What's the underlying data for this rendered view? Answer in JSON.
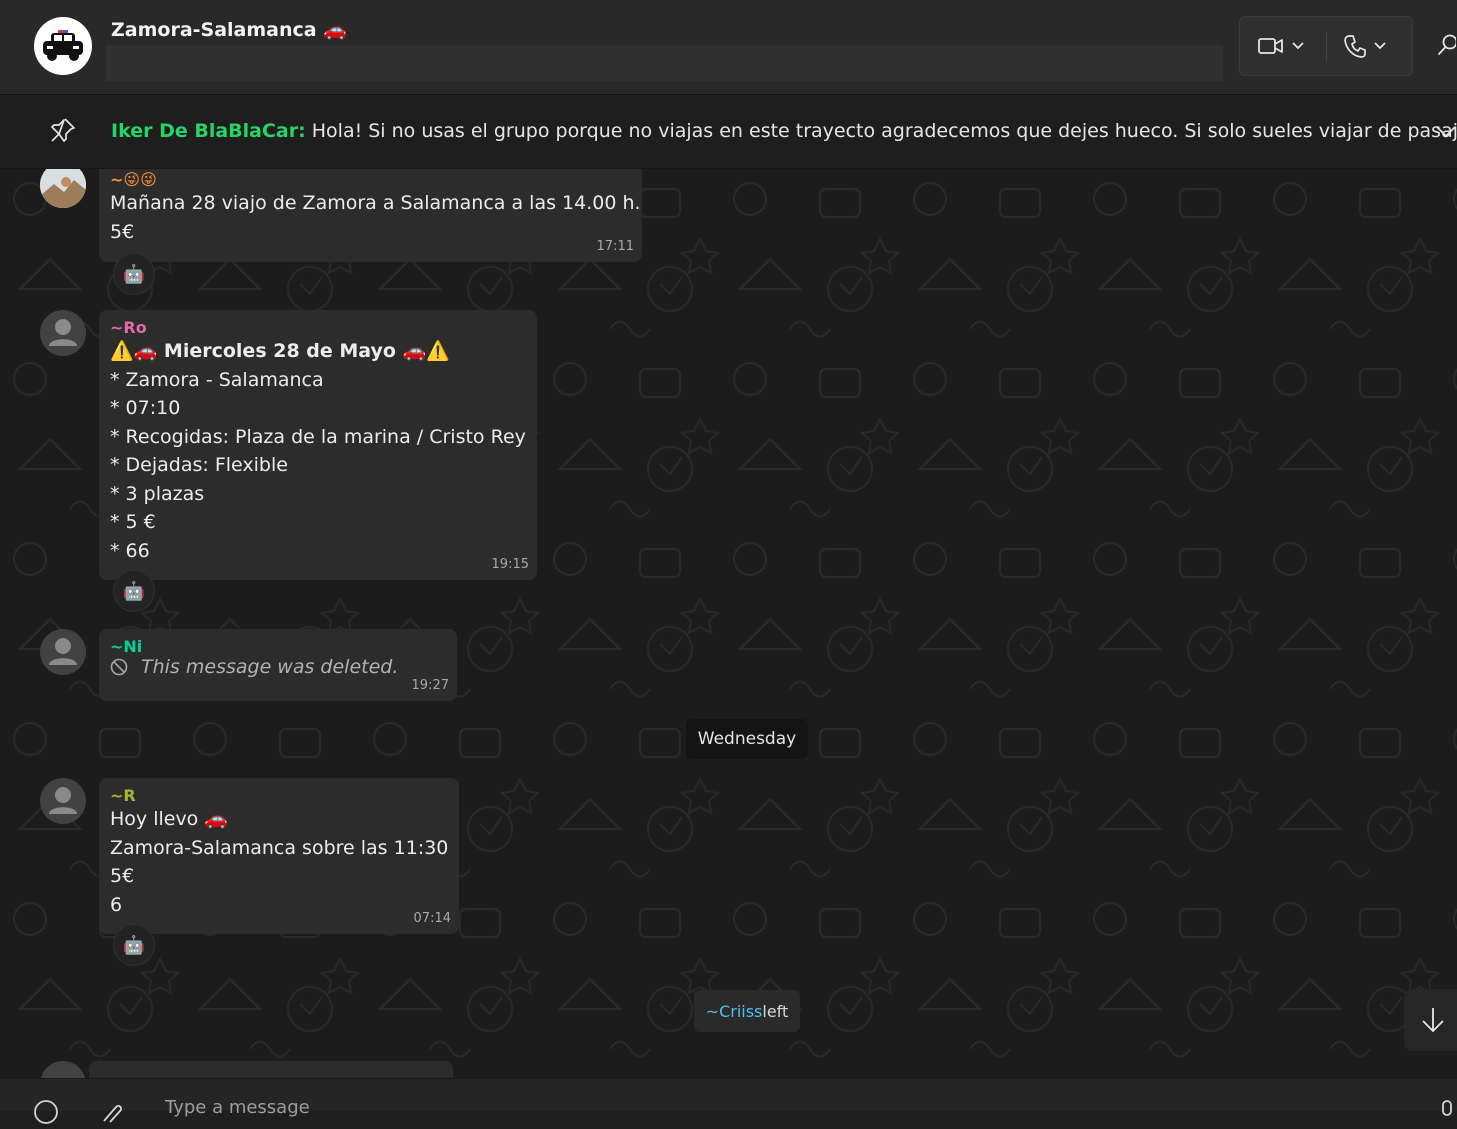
{
  "header": {
    "title": "Zamora-Salamanca 🚗",
    "video_icon": "video-camera-icon",
    "voice_icon": "phone-icon",
    "search_icon": "search-icon"
  },
  "pinned": {
    "icon": "pin-icon",
    "sender": "Iker De BlaBlaCar:",
    "text": " Hola! Si no usas el grupo porque no viajas en este trayecto agradecemos que dejes hueco. Si solo sueles viajar de pasaje..."
  },
  "messages": [
    {
      "sender": "~😜😜",
      "sender_color": "#ff8c3a",
      "lines": [
        "Mañana 28 viajo de Zamora a Salamanca a las 14.00 h.",
        "5€"
      ],
      "time": "17:11",
      "reaction": "🤖"
    },
    {
      "sender": "~Ro",
      "sender_color": "#e36aa6",
      "lines": [
        "⚠️🚗 Miercoles 28 de Mayo 🚗⚠️",
        "* Zamora - Salamanca",
        "* 07:10",
        "* Recogidas: Plaza de la marina / Cristo Rey",
        "* Dejadas: Flexible",
        "* 3 plazas",
        "* 5 €",
        "* 66"
      ],
      "time": "19:15",
      "reaction": "🤖"
    },
    {
      "sender": "~Ni",
      "sender_color": "#06cf9c",
      "deleted_text": "This message was deleted.",
      "time": "19:27"
    },
    {
      "sender": "~R",
      "sender_color": "#a5b337",
      "lines": [
        "Hoy llevo 🚗",
        "Zamora-Salamanca sobre las 11:30",
        "5€",
        "6"
      ],
      "time": "07:14",
      "reaction": "🤖"
    }
  ],
  "date_divider": "Wednesday",
  "system": {
    "who": "~Criiss",
    "action": " left"
  },
  "composer": {
    "placeholder": "Type a message"
  },
  "colors": {
    "accent_green": "#25d366",
    "bubble_bg": "#2c2c2c",
    "header_bg": "#292929"
  }
}
